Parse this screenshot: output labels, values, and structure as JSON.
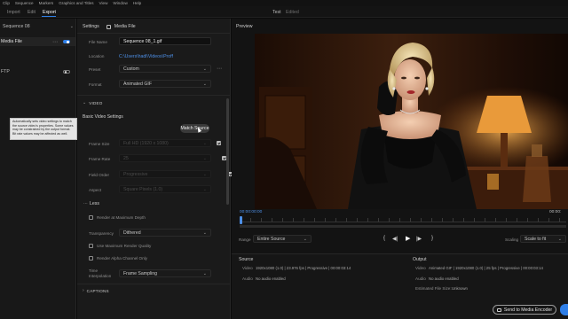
{
  "menu": [
    "Clip",
    "Sequence",
    "Markers",
    "Graphics and Titles",
    "View",
    "Window",
    "Help"
  ],
  "tabs": {
    "import": "Import",
    "edit": "Edit",
    "export": "Export"
  },
  "project": {
    "title": "Test",
    "status": "Edited"
  },
  "left_panel": {
    "sequence": "Sequence 08",
    "items": [
      {
        "label": "Media File",
        "enabled": true
      },
      {
        "label": "FTP",
        "enabled": false
      }
    ]
  },
  "tooltip": {
    "text": "Automatically sets video settings to match the source video's properties. Some values may be constrained by the output format. Bit rate values may be affected as well."
  },
  "settings": {
    "header": "Settings",
    "media_file": "Media File",
    "file_name_label": "File Name",
    "file_name_value": "Sequence 08_1.gif",
    "location_label": "Location",
    "location_value": "C:\\Users\\hadi\\Videos\\Proff",
    "preset_label": "Preset",
    "preset_value": "Custom",
    "format_label": "Format",
    "format_value": "Animated GIF",
    "video_section": "VIDEO",
    "basic_video": "Basic Video Settings",
    "match_source": "Match Source",
    "frame_size_label": "Frame Size",
    "frame_size_value": "Full HD (1920 x 1080)",
    "frame_rate_label": "Frame Rate",
    "frame_rate_value": "25",
    "field_order_label": "Field Order",
    "field_order_value": "Progressive",
    "aspect_label": "Aspect",
    "aspect_value": "Square Pixels (1.0)",
    "less": "Less",
    "render_max_depth": "Render at Maximum Depth",
    "transparency_label": "Transparency",
    "transparency_value": "Dithered",
    "max_render_quality": "Use Maximum Render Quality",
    "render_alpha": "Render Alpha Channel Only",
    "time_interp_label": "Time Interpolation",
    "time_interp_value": "Frame Sampling",
    "captions": "CAPTIONS"
  },
  "preview": {
    "header": "Preview",
    "timecode_start": "00:00:00:00",
    "timecode_end": "00:00:",
    "range_label": "Range",
    "range_value": "Entire Source",
    "scaling_label": "Scaling",
    "scaling_value": "Scale to fit"
  },
  "source_info": {
    "header": "Source",
    "video_label": "Video",
    "video_value": "1920x1080 (1.0)  |  23.976 fps  |  Progressive  |  00:00:03:14",
    "audio_label": "Audio",
    "audio_value": "No audio enabled"
  },
  "output_info": {
    "header": "Output",
    "video_label": "Video",
    "video_value": "Animated GIF  |  1920x1080 (1.0)  |  25 fps  |  Progressive  |  00:00:03:14",
    "audio_label": "Audio",
    "audio_value": "No audio enabled",
    "size_label": "Estimated File Size:",
    "size_value": "Unknown"
  },
  "send_button": "Send to Media Encoder",
  "colors": {
    "accent": "#2f7fe8",
    "panel": "#1d1d1d",
    "bg": "#0b0b0b"
  }
}
